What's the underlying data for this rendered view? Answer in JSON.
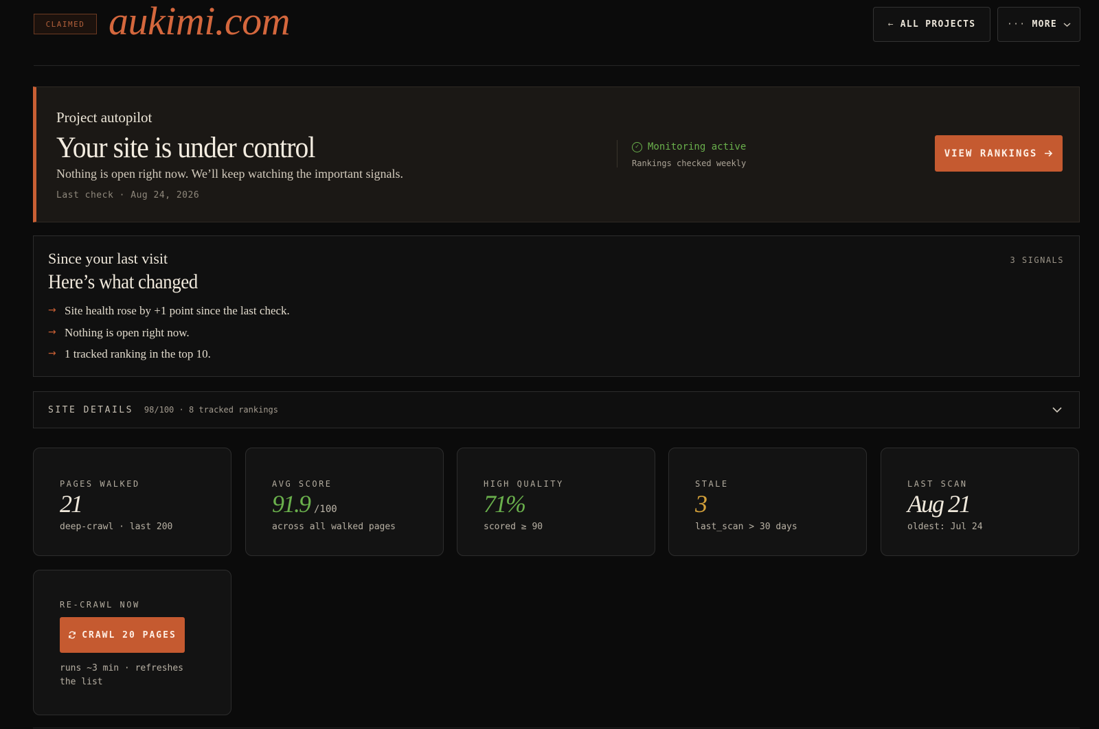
{
  "header": {
    "badge": "CLAIMED",
    "site_title": "aukimi.com",
    "all_projects": {
      "label": "ALL PROJECTS",
      "icon": "arrow-left-icon",
      "glyph": "←"
    },
    "more": {
      "label": "MORE",
      "icon": "ellipsis-icon",
      "glyph": "···",
      "chevron": "chevron-down-icon"
    }
  },
  "autopilot": {
    "eyebrow": "Project autopilot",
    "title": "Your site is under control",
    "subtitle": "Nothing is open right now. We’ll keep watching the important signals.",
    "last_check": "Last check · Aug 24, 2026",
    "status_label": "Monitoring active",
    "status_sub": "Rankings checked weekly",
    "cta_label": "VIEW RANKINGS",
    "cta_icon": "arrow-right-icon"
  },
  "changes": {
    "eyebrow": "Since your last visit",
    "title": "Here’s what changed",
    "count": "3 SIGNALS",
    "items": [
      "Site health rose by +1 point since the last check.",
      "Nothing is open right now.",
      "1 tracked ranking in the top 10."
    ]
  },
  "details": {
    "label": "SITE DETAILS",
    "meta": "98/100 · 8 tracked rankings"
  },
  "stats": [
    {
      "label": "PAGES WALKED",
      "value": "21",
      "unit": "",
      "note": "deep-crawl · last 200",
      "color": "#f0e9dc"
    },
    {
      "label": "AVG SCORE",
      "value": "91.9",
      "unit": "/100",
      "note": "across all walked pages",
      "color": "#6ab04c"
    },
    {
      "label": "HIGH QUALITY",
      "value": "71%",
      "unit": "",
      "note": "scored ≥ 90",
      "color": "#6ab04c"
    },
    {
      "label": "STALE",
      "value": "3",
      "unit": "",
      "note": "last_scan > 30 days",
      "color": "#d4a13a"
    },
    {
      "label": "LAST SCAN",
      "value": "Aug 21",
      "unit": "",
      "note": "oldest: Jul 24",
      "color": "#f0e9dc"
    }
  ],
  "recrawl": {
    "label": "RE-CRAWL NOW",
    "button": "CRAWL 20 PAGES",
    "button_icon": "refresh-icon",
    "note": "runs ~3 min · refreshes the list"
  },
  "colors": {
    "accent": "#c55a30",
    "positive": "#6ab04c",
    "warning": "#d4a13a",
    "background": "#0b0b0b"
  }
}
